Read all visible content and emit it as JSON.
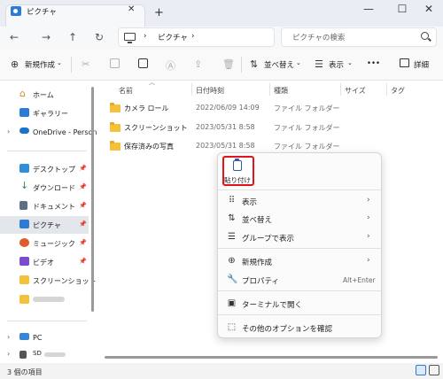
{
  "window": {
    "tab_title": "ピクチャ",
    "close_tab_glyph": "✕",
    "new_tab_glyph": "+",
    "minimize_glyph": "—",
    "maximize_glyph": "☐",
    "close_glyph": "✕"
  },
  "nav": {
    "back_glyph": "←",
    "forward_glyph": "→",
    "up_glyph": "↑",
    "refresh_glyph": "↻",
    "breadcrumb_sep1": "›",
    "breadcrumb": "ピクチャ",
    "breadcrumb_sep2": "›",
    "search_placeholder": "ピクチャの検索"
  },
  "toolbar": {
    "new_label": "新規作成",
    "sort_label": "並べ替え",
    "view_label": "表示",
    "more_label": "•••",
    "details_label": "詳細",
    "dropdown_glyph": "⌄"
  },
  "sidebar": {
    "items": [
      {
        "label": "ホーム",
        "icon": "home-icon"
      },
      {
        "label": "ギャラリー",
        "icon": "gallery-icon"
      },
      {
        "label": "OneDrive - Person",
        "icon": "onedrive-icon"
      },
      {
        "label": "デスクトップ",
        "icon": "desktop-icon"
      },
      {
        "label": "ダウンロード",
        "icon": "download-icon"
      },
      {
        "label": "ドキュメント",
        "icon": "documents-icon"
      },
      {
        "label": "ピクチャ",
        "icon": "pictures-icon"
      },
      {
        "label": "ミュージック",
        "icon": "music-icon"
      },
      {
        "label": "ビデオ",
        "icon": "videos-icon"
      },
      {
        "label": "スクリーンショット",
        "icon": "folder-icon"
      },
      {
        "label": "PC",
        "icon": "pc-icon"
      },
      {
        "label": "SD",
        "icon": "sd-card-icon"
      }
    ],
    "pin_glyph": "📌",
    "chevron_glyph": "›"
  },
  "columns": [
    "名前",
    "日付時刻",
    "種類",
    "サイズ",
    "タグ"
  ],
  "files": [
    {
      "name": "カメラ ロール",
      "date": "2022/06/09 14:09",
      "type": "ファイル フォルダー"
    },
    {
      "name": "スクリーンショット",
      "date": "2023/05/31 8:58",
      "type": "ファイル フォルダー"
    },
    {
      "name": "保存済みの写真",
      "date": "2023/05/31 8:58",
      "type": "ファイル フォルダー"
    }
  ],
  "status": {
    "item_count": "3 個の項目"
  },
  "context_menu": {
    "paste_label": "貼り付け",
    "items": [
      {
        "label": "表示",
        "icon": "⠿",
        "arrow": "›"
      },
      {
        "label": "並べ替え",
        "icon": "⇅",
        "arrow": "›"
      },
      {
        "label": "グループで表示",
        "icon": "☰",
        "arrow": "›"
      },
      {
        "label": "新規作成",
        "icon": "⊕",
        "arrow": "›"
      },
      {
        "label": "プロパティ",
        "icon": "🔧",
        "shortcut": "Alt+Enter"
      },
      {
        "label": "ターミナルで開く",
        "icon": "▣"
      },
      {
        "label": "その他のオプションを確認",
        "icon": "⬚"
      }
    ]
  },
  "colors": {
    "accent": "#2d7bd4",
    "highlight_box": "#e2141a",
    "folder": "#f4c23a"
  }
}
